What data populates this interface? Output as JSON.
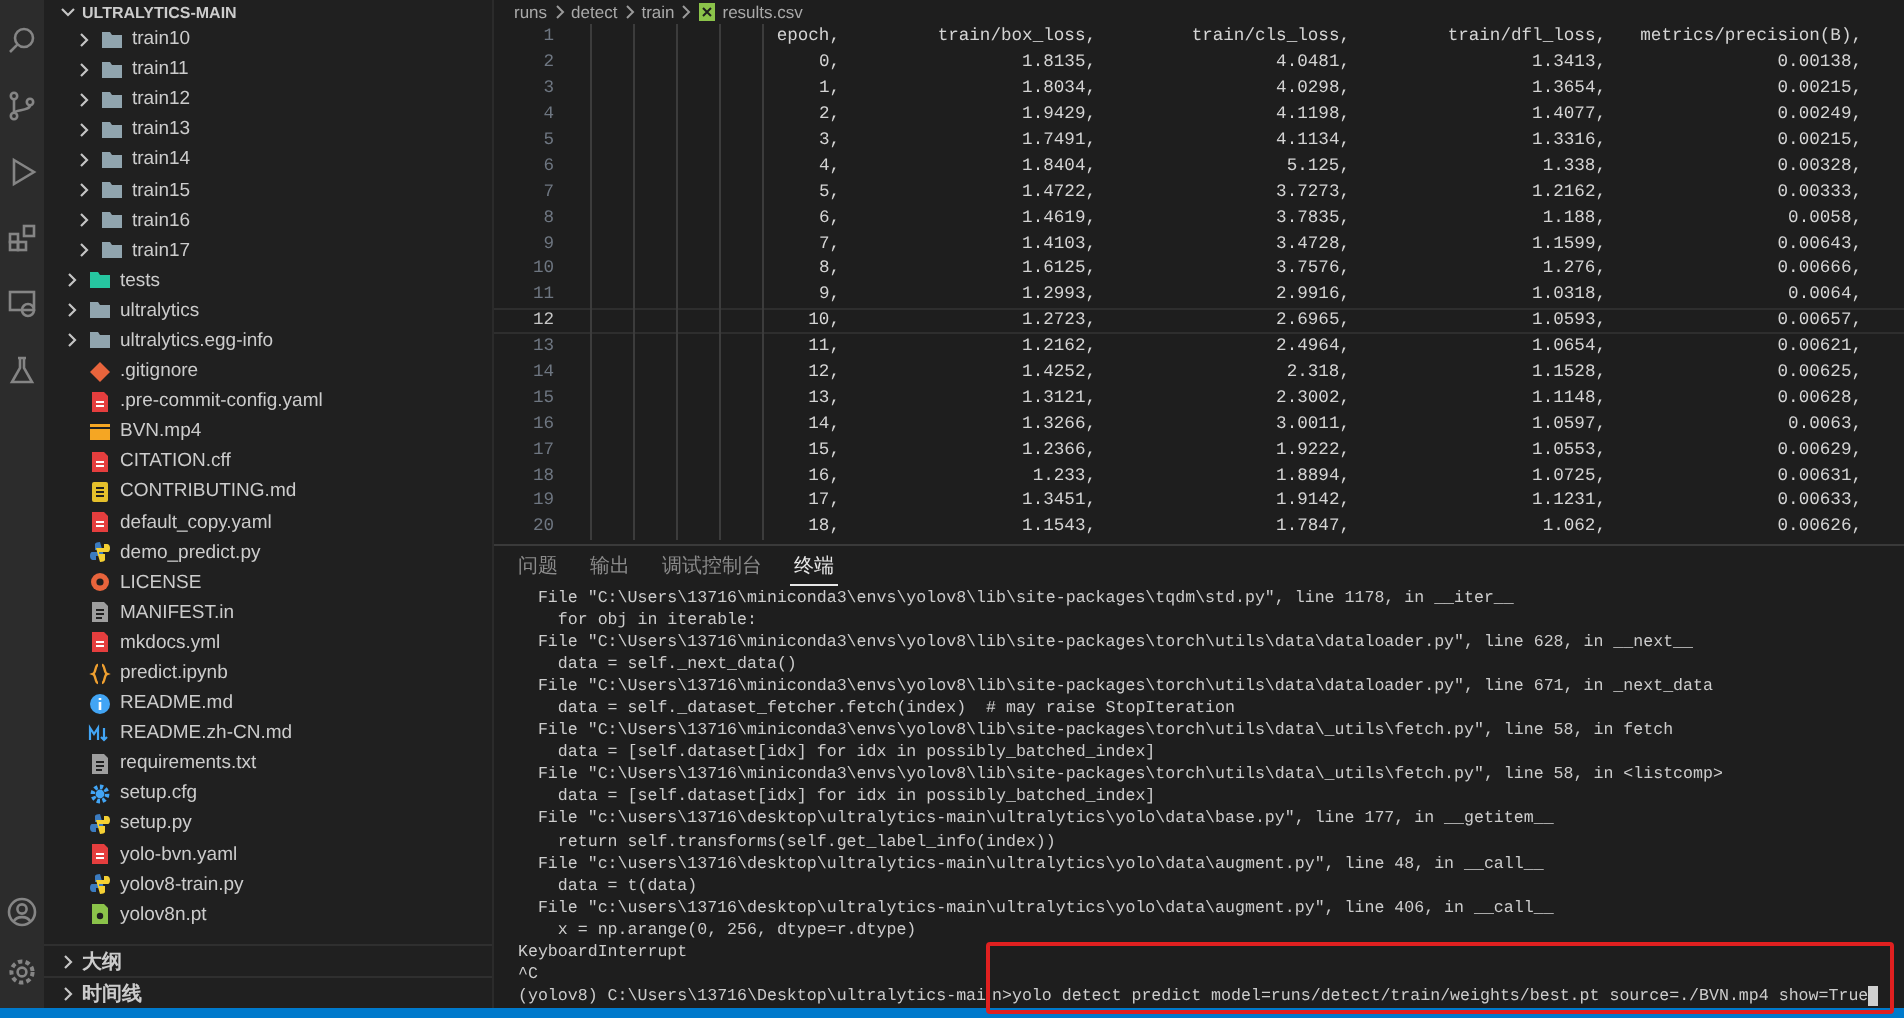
{
  "sidebar": {
    "title": "ULTRALYTICS-MAIN",
    "tree": [
      {
        "children": [
          {
            "label": "train10",
            "kind": "folder",
            "expanded": false
          },
          {
            "label": "train11",
            "kind": "folder",
            "expanded": false
          },
          {
            "label": "train12",
            "kind": "folder",
            "expanded": false
          },
          {
            "label": "train13",
            "kind": "folder",
            "expanded": false
          },
          {
            "label": "train14",
            "kind": "folder",
            "expanded": false
          },
          {
            "label": "train15",
            "kind": "folder",
            "expanded": false
          },
          {
            "label": "train16",
            "kind": "folder",
            "expanded": false
          },
          {
            "label": "train17",
            "kind": "folder",
            "expanded": false
          }
        ]
      },
      {
        "label": "tests",
        "kind": "test-folder",
        "expanded": false
      },
      {
        "label": "ultralytics",
        "kind": "folder",
        "expanded": false
      },
      {
        "label": "ultralytics.egg-info",
        "kind": "folder",
        "expanded": false
      },
      {
        "label": ".gitignore",
        "kind": "git"
      },
      {
        "label": ".pre-commit-config.yaml",
        "kind": "yaml"
      },
      {
        "label": "BVN.mp4",
        "kind": "video"
      },
      {
        "label": "CITATION.cff",
        "kind": "yaml"
      },
      {
        "label": "CONTRIBUTING.md",
        "kind": "doc"
      },
      {
        "label": "default_copy.yaml",
        "kind": "yaml"
      },
      {
        "label": "demo_predict.py",
        "kind": "python"
      },
      {
        "label": "LICENSE",
        "kind": "license"
      },
      {
        "label": "MANIFEST.in",
        "kind": "text"
      },
      {
        "label": "mkdocs.yml",
        "kind": "yaml"
      },
      {
        "label": "predict.ipynb",
        "kind": "notebook"
      },
      {
        "label": "README.md",
        "kind": "info"
      },
      {
        "label": "README.zh-CN.md",
        "kind": "markdown"
      },
      {
        "label": "requirements.txt",
        "kind": "text"
      },
      {
        "label": "setup.cfg",
        "kind": "config"
      },
      {
        "label": "setup.py",
        "kind": "python"
      },
      {
        "label": "yolo-bvn.yaml",
        "kind": "yaml"
      },
      {
        "label": "yolov8-train.py",
        "kind": "python"
      },
      {
        "label": "yolov8n.pt",
        "kind": "model"
      }
    ],
    "sections": [
      {
        "label": "大纲",
        "expanded": false
      },
      {
        "label": "时间线",
        "expanded": false
      }
    ]
  },
  "breadcrumb": [
    "runs",
    "detect",
    "train",
    "results.csv"
  ],
  "editor": {
    "rows": [
      {
        "line": "1",
        "current": false,
        "cells": [
          "epoch,",
          "train/box_loss,",
          "train/cls_loss,",
          "train/dfl_loss,",
          "metrics/precision(B),"
        ]
      },
      {
        "line": "2",
        "current": false,
        "cells": [
          "0,",
          "1.8135,",
          "4.0481,",
          "1.3413,",
          "0.00138,"
        ]
      },
      {
        "line": "3",
        "current": false,
        "cells": [
          "1,",
          "1.8034,",
          "4.0298,",
          "1.3654,",
          "0.00215,"
        ]
      },
      {
        "line": "4",
        "current": false,
        "cells": [
          "2,",
          "1.9429,",
          "4.1198,",
          "1.4077,",
          "0.00249,"
        ]
      },
      {
        "line": "5",
        "current": false,
        "cells": [
          "3,",
          "1.7491,",
          "4.1134,",
          "1.3316,",
          "0.00215,"
        ]
      },
      {
        "line": "6",
        "current": false,
        "cells": [
          "4,",
          "1.8404,",
          "5.125,",
          "1.338,",
          "0.00328,"
        ]
      },
      {
        "line": "7",
        "current": false,
        "cells": [
          "5,",
          "1.4722,",
          "3.7273,",
          "1.2162,",
          "0.00333,"
        ]
      },
      {
        "line": "8",
        "current": false,
        "cells": [
          "6,",
          "1.4619,",
          "3.7835,",
          "1.188,",
          "0.0058,"
        ]
      },
      {
        "line": "9",
        "current": false,
        "cells": [
          "7,",
          "1.4103,",
          "3.4728,",
          "1.1599,",
          "0.00643,"
        ]
      },
      {
        "line": "10",
        "current": false,
        "cells": [
          "8,",
          "1.6125,",
          "3.7576,",
          "1.276,",
          "0.00666,"
        ]
      },
      {
        "line": "11",
        "current": false,
        "cells": [
          "9,",
          "1.2993,",
          "2.9916,",
          "1.0318,",
          "0.0064,"
        ]
      },
      {
        "line": "12",
        "current": true,
        "cells": [
          "10,",
          "1.2723,",
          "2.6965,",
          "1.0593,",
          "0.00657,"
        ]
      },
      {
        "line": "13",
        "current": false,
        "cells": [
          "11,",
          "1.2162,",
          "2.4964,",
          "1.0654,",
          "0.00621,"
        ]
      },
      {
        "line": "14",
        "current": false,
        "cells": [
          "12,",
          "1.4252,",
          "2.318,",
          "1.1528,",
          "0.00625,"
        ]
      },
      {
        "line": "15",
        "current": false,
        "cells": [
          "13,",
          "1.3121,",
          "2.3002,",
          "1.1148,",
          "0.00628,"
        ]
      },
      {
        "line": "16",
        "current": false,
        "cells": [
          "14,",
          "1.3266,",
          "3.0011,",
          "1.0597,",
          "0.0063,"
        ]
      },
      {
        "line": "17",
        "current": false,
        "cells": [
          "15,",
          "1.2366,",
          "1.9222,",
          "1.0553,",
          "0.00629,"
        ]
      },
      {
        "line": "18",
        "current": false,
        "cells": [
          "16,",
          "1.233,",
          "1.8894,",
          "1.0725,",
          "0.00631,"
        ]
      },
      {
        "line": "19",
        "current": false,
        "cells": [
          "17,",
          "1.3451,",
          "1.9142,",
          "1.1231,",
          "0.00633,"
        ]
      },
      {
        "line": "20",
        "current": false,
        "cells": [
          "18,",
          "1.1543,",
          "1.7847,",
          "1.062,",
          "0.00626,"
        ]
      }
    ]
  },
  "panel": {
    "tabs": [
      {
        "label": "问题",
        "selected": false
      },
      {
        "label": "输出",
        "selected": false
      },
      {
        "label": "调试控制台",
        "selected": false
      },
      {
        "label": "终端",
        "selected": true
      }
    ],
    "terminal": {
      "lines": [
        "  File \"C:\\Users\\13716\\miniconda3\\envs\\yolov8\\lib\\site-packages\\tqdm\\std.py\", line 1178, in __iter__",
        "    for obj in iterable:",
        "  File \"C:\\Users\\13716\\miniconda3\\envs\\yolov8\\lib\\site-packages\\torch\\utils\\data\\dataloader.py\", line 628, in __next__",
        "    data = self._next_data()",
        "  File \"C:\\Users\\13716\\miniconda3\\envs\\yolov8\\lib\\site-packages\\torch\\utils\\data\\dataloader.py\", line 671, in _next_data",
        "    data = self._dataset_fetcher.fetch(index)  # may raise StopIteration",
        "  File \"C:\\Users\\13716\\miniconda3\\envs\\yolov8\\lib\\site-packages\\torch\\utils\\data\\_utils\\fetch.py\", line 58, in fetch",
        "    data = [self.dataset[idx] for idx in possibly_batched_index]",
        "  File \"C:\\Users\\13716\\miniconda3\\envs\\yolov8\\lib\\site-packages\\torch\\utils\\data\\_utils\\fetch.py\", line 58, in <listcomp>",
        "    data = [self.dataset[idx] for idx in possibly_batched_index]",
        "  File \"c:\\users\\13716\\desktop\\ultralytics-main\\ultralytics\\yolo\\data\\base.py\", line 177, in __getitem__",
        "    return self.transforms(self.get_label_info(index))",
        "  File \"c:\\users\\13716\\desktop\\ultralytics-main\\ultralytics\\yolo\\data\\augment.py\", line 48, in __call__",
        "    data = t(data)",
        "  File \"c:\\users\\13716\\desktop\\ultralytics-main\\ultralytics\\yolo\\data\\augment.py\", line 406, in __call__",
        "    x = np.arange(0, 256, dtype=r.dtype)",
        "KeyboardInterrupt",
        "^C"
      ],
      "prompt": "(yolov8) C:\\Users\\13716\\Desktop\\ultralytics-mai",
      "command": "n>yolo detect predict model=runs/detect/train/weights/best.pt source=./BVN.mp4 show=True",
      "command_highlighted": true
    }
  }
}
